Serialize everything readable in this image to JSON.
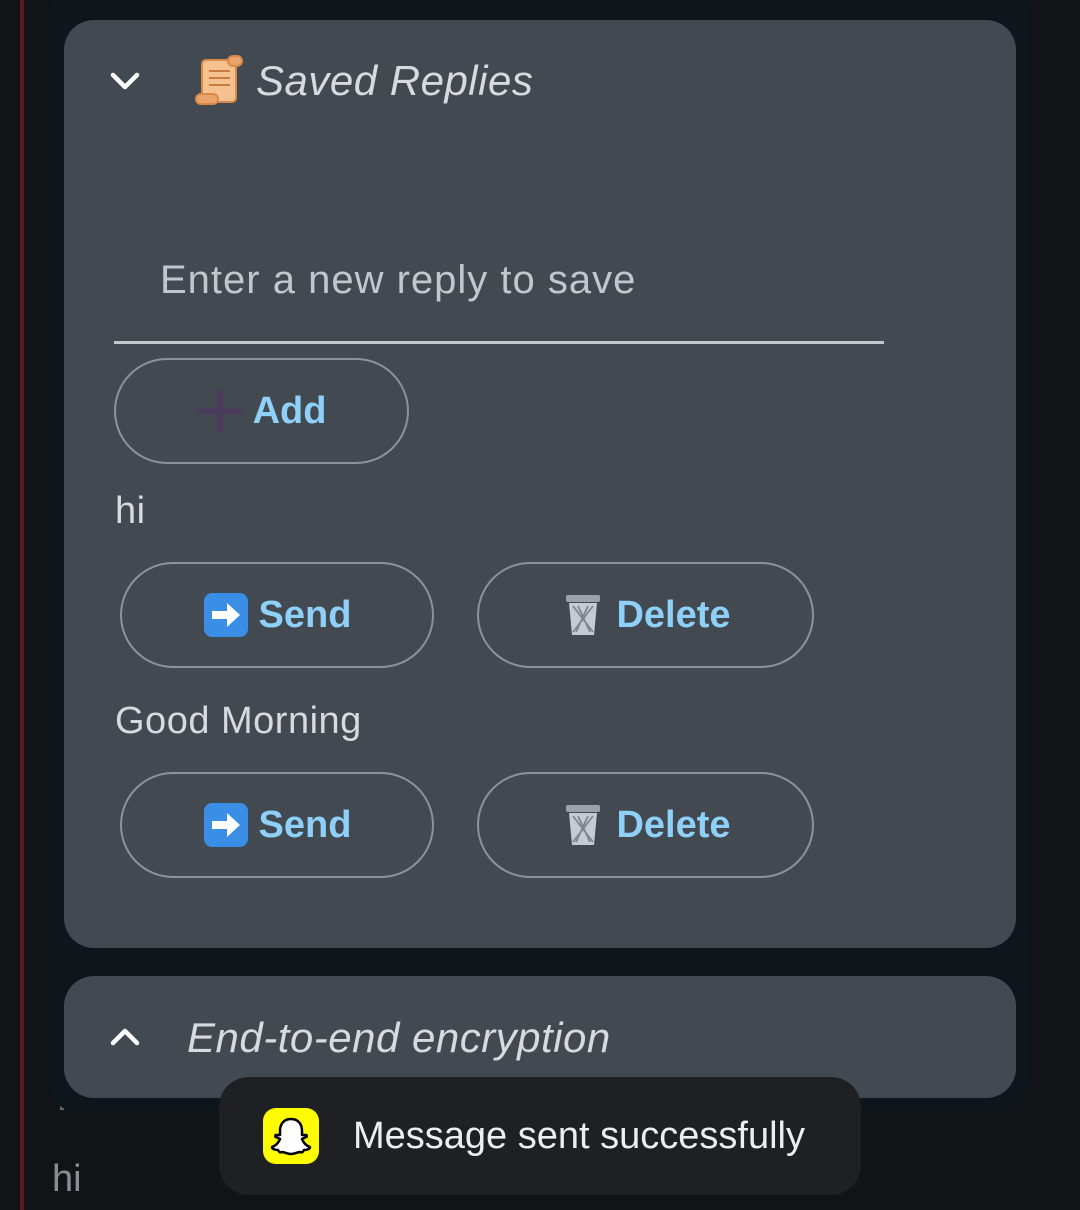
{
  "saved_replies": {
    "title": "Saved Replies",
    "input_placeholder": "Enter a new reply to save",
    "add_label": "Add",
    "replies": [
      {
        "text": "hi",
        "send_label": "Send",
        "delete_label": "Delete"
      },
      {
        "text": "Good Morning",
        "send_label": "Send",
        "delete_label": "Delete"
      }
    ]
  },
  "e2e_section": {
    "title": "End-to-end encryption"
  },
  "background_chat": {
    "message": "hi"
  },
  "toast": {
    "message": "Message sent successfully"
  },
  "colors": {
    "button_text": "#8fd0f8",
    "card_bg": "#424950",
    "toast_icon_bg": "#fffc00"
  }
}
